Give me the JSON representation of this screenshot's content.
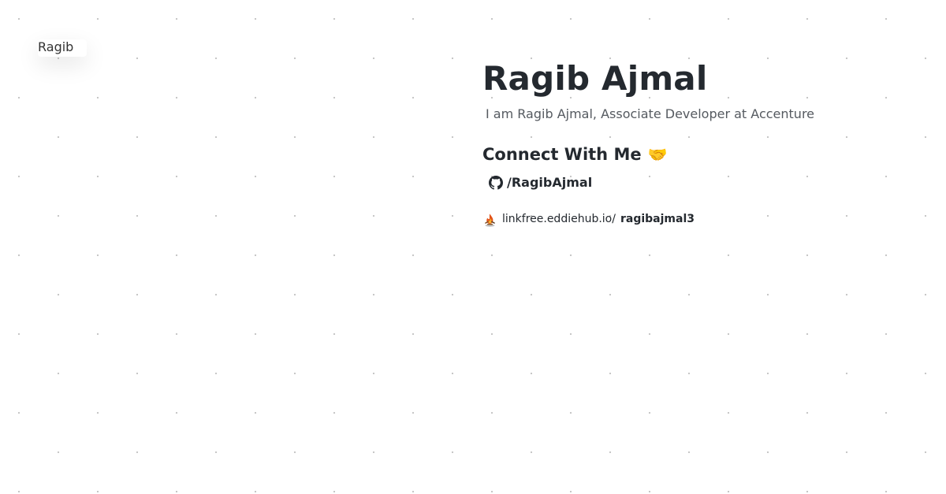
{
  "profile": {
    "avatar_alt": "Ragib",
    "name": "Ragib Ajmal",
    "bio": "I am Ragib Ajmal, Associate Developer at Accenture"
  },
  "connect": {
    "heading": "Connect With Me",
    "heading_emoji": "🤝",
    "github": {
      "icon": "github-icon",
      "label": "/RagibAjmal"
    },
    "linkfree": {
      "icon": "linkfree-icon",
      "domain": "linkfree.eddiehub.io/",
      "username": "ragibajmal3"
    }
  },
  "colors": {
    "background": "#ffffff",
    "dot_grid": "#c4c4c4",
    "text_primary": "#24292f",
    "text_secondary": "#555a60"
  }
}
